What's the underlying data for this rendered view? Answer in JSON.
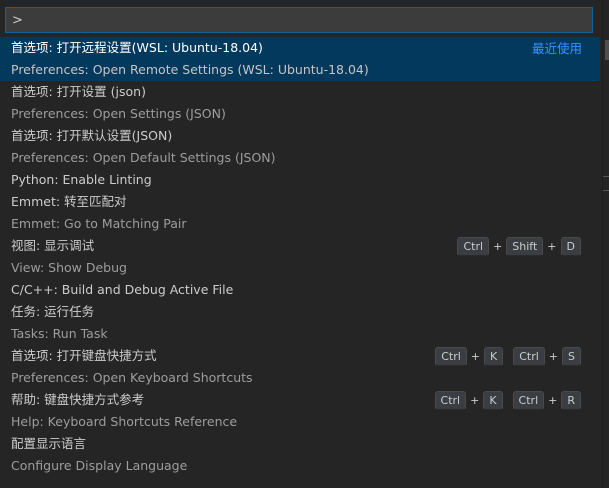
{
  "search": {
    "value": ">"
  },
  "items": [
    {
      "label": "首选项: 打开远程设置(WSL: Ubuntu-18.04)",
      "detail": "Preferences: Open Remote Settings (WSL: Ubuntu-18.04)",
      "badge": "最近使用"
    },
    {
      "label": "首选项: 打开设置 (json)",
      "detail": "Preferences: Open Settings (JSON)"
    },
    {
      "label": "首选项: 打开默认设置(JSON)",
      "detail": "Preferences: Open Default Settings (JSON)"
    },
    {
      "label": "Python: Enable Linting"
    },
    {
      "label": "Emmet: 转至匹配对",
      "detail": "Emmet: Go to Matching Pair"
    },
    {
      "label": "视图: 显示调试",
      "detail": "View: Show Debug",
      "keys": [
        "Ctrl",
        "Shift",
        "D"
      ]
    },
    {
      "label": "C/C++: Build and Debug Active File"
    },
    {
      "label": "任务: 运行任务",
      "detail": "Tasks: Run Task"
    },
    {
      "label": "首选项: 打开键盘快捷方式",
      "detail": "Preferences: Open Keyboard Shortcuts",
      "chord1": [
        "Ctrl",
        "K"
      ],
      "chord2": [
        "Ctrl",
        "S"
      ]
    },
    {
      "label": "帮助: 键盘快捷方式参考",
      "detail": "Help: Keyboard Shortcuts Reference",
      "chord1": [
        "Ctrl",
        "K"
      ],
      "chord2": [
        "Ctrl",
        "R"
      ]
    },
    {
      "label": "配置显示语言",
      "detail": "Configure Display Language"
    }
  ]
}
